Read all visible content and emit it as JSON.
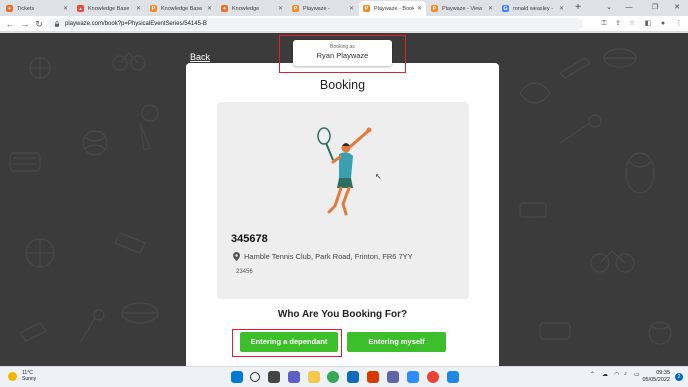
{
  "browser": {
    "tabs": [
      {
        "title": "Tickets",
        "fav_color": "#e8702a",
        "fav_glyph": "✦",
        "active": false
      },
      {
        "title": "Knowledge Base",
        "fav_color": "#e74c3c",
        "fav_glyph": "▴",
        "active": false
      },
      {
        "title": "Knowledge Base",
        "fav_color": "#f08a24",
        "fav_glyph": "P",
        "active": false
      },
      {
        "title": "Knowledge",
        "fav_color": "#e8702a",
        "fav_glyph": "✦",
        "active": false
      },
      {
        "title": "Playwaze -",
        "fav_color": "#f08a24",
        "fav_glyph": "P",
        "active": false
      },
      {
        "title": "Playwaze - Booki",
        "fav_color": "#f08a24",
        "fav_glyph": "P",
        "active": true
      },
      {
        "title": "Playwaze - View ",
        "fav_color": "#f08a24",
        "fav_glyph": "P",
        "active": false
      },
      {
        "title": "ronald weasley -",
        "fav_color": "#4285f4",
        "fav_glyph": "G",
        "active": false
      }
    ],
    "new_tab": "+",
    "url": "playwaze.com/book?p=PhysicalEventSeries/54145-B"
  },
  "page": {
    "back_label": "Back",
    "booking_as_label": "Booking as",
    "booking_as_name": "Ryan Playwaze",
    "card_title": "Booking",
    "event_number": "345678",
    "event_location": "Hamble Tennis Club, Park Road, Frinton, FR6 7YY",
    "event_code": "23456",
    "who_title": "Who Are You Booking For?",
    "btn_dependant": "Entering a dependant",
    "btn_myself": "Entering myself",
    "accent_green": "#3dbf2c",
    "highlight_red": "#e0202a"
  },
  "taskbar": {
    "temp": "11°C",
    "weather": "Sunny",
    "time": "09:35",
    "date": "05/05/2022",
    "notif_count": "2"
  }
}
